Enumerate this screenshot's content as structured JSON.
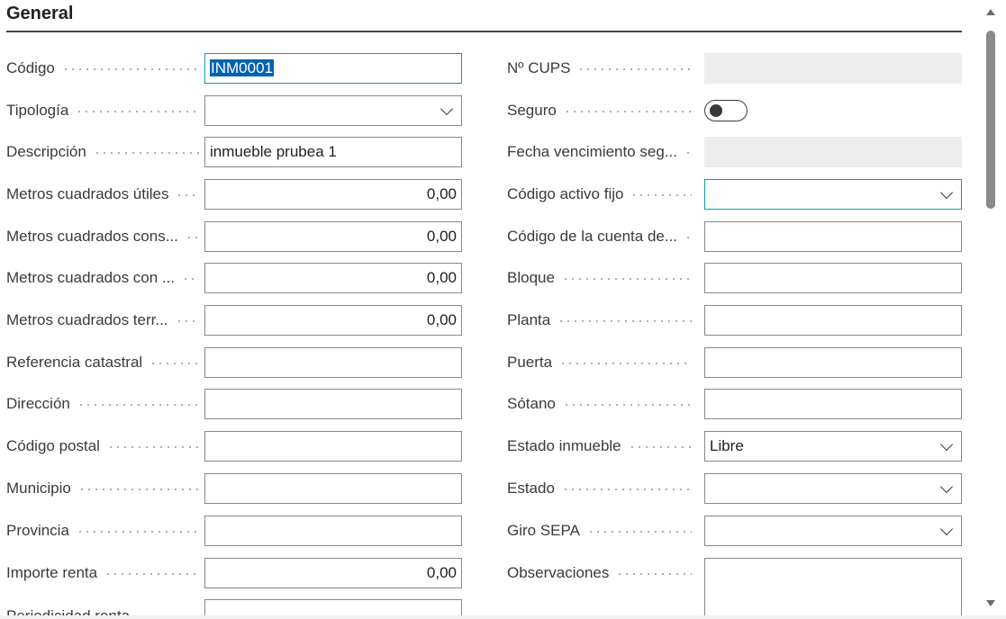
{
  "section": {
    "title": "General"
  },
  "left_fields": [
    {
      "label": "Código",
      "value": "INM0001"
    },
    {
      "label": "Tipología",
      "value": ""
    },
    {
      "label": "Descripción",
      "value": "inmueble prubea 1"
    },
    {
      "label": "Metros cuadrados útiles",
      "value": "0,00"
    },
    {
      "label": "Metros cuadrados cons...",
      "value": "0,00"
    },
    {
      "label": "Metros cuadrados con ...",
      "value": "0,00"
    },
    {
      "label": "Metros cuadrados terr...",
      "value": "0,00"
    },
    {
      "label": "Referencia catastral",
      "value": ""
    },
    {
      "label": "Dirección",
      "value": ""
    },
    {
      "label": "Código postal",
      "value": ""
    },
    {
      "label": "Municipio",
      "value": ""
    },
    {
      "label": "Provincia",
      "value": ""
    },
    {
      "label": "Importe renta",
      "value": "0,00"
    },
    {
      "label": "Periodicidad renta",
      "value": ""
    }
  ],
  "right_fields": [
    {
      "label": "Nº CUPS",
      "value": ""
    },
    {
      "label": "Seguro",
      "value": "off"
    },
    {
      "label": "Fecha vencimiento seg...",
      "value": ""
    },
    {
      "label": "Código activo fijo",
      "value": ""
    },
    {
      "label": "Código de la cuenta de...",
      "value": ""
    },
    {
      "label": "Bloque",
      "value": ""
    },
    {
      "label": "Planta",
      "value": ""
    },
    {
      "label": "Puerta",
      "value": ""
    },
    {
      "label": "Sótano",
      "value": ""
    },
    {
      "label": "Estado inmueble",
      "value": "Libre"
    },
    {
      "label": "Estado",
      "value": ""
    },
    {
      "label": "Giro SEPA",
      "value": ""
    },
    {
      "label": "Observaciones",
      "value": ""
    }
  ],
  "icons": {
    "dropdown": "chevron-down-icon",
    "scroll_up": "scroll-up-arrow-icon",
    "scroll_down": "scroll-down-arrow-icon"
  },
  "colors": {
    "focus_border": "#0f9ba0",
    "selection": "#0063b1",
    "header_rule": "#3a4750",
    "readonly_bg": "#ededed"
  }
}
